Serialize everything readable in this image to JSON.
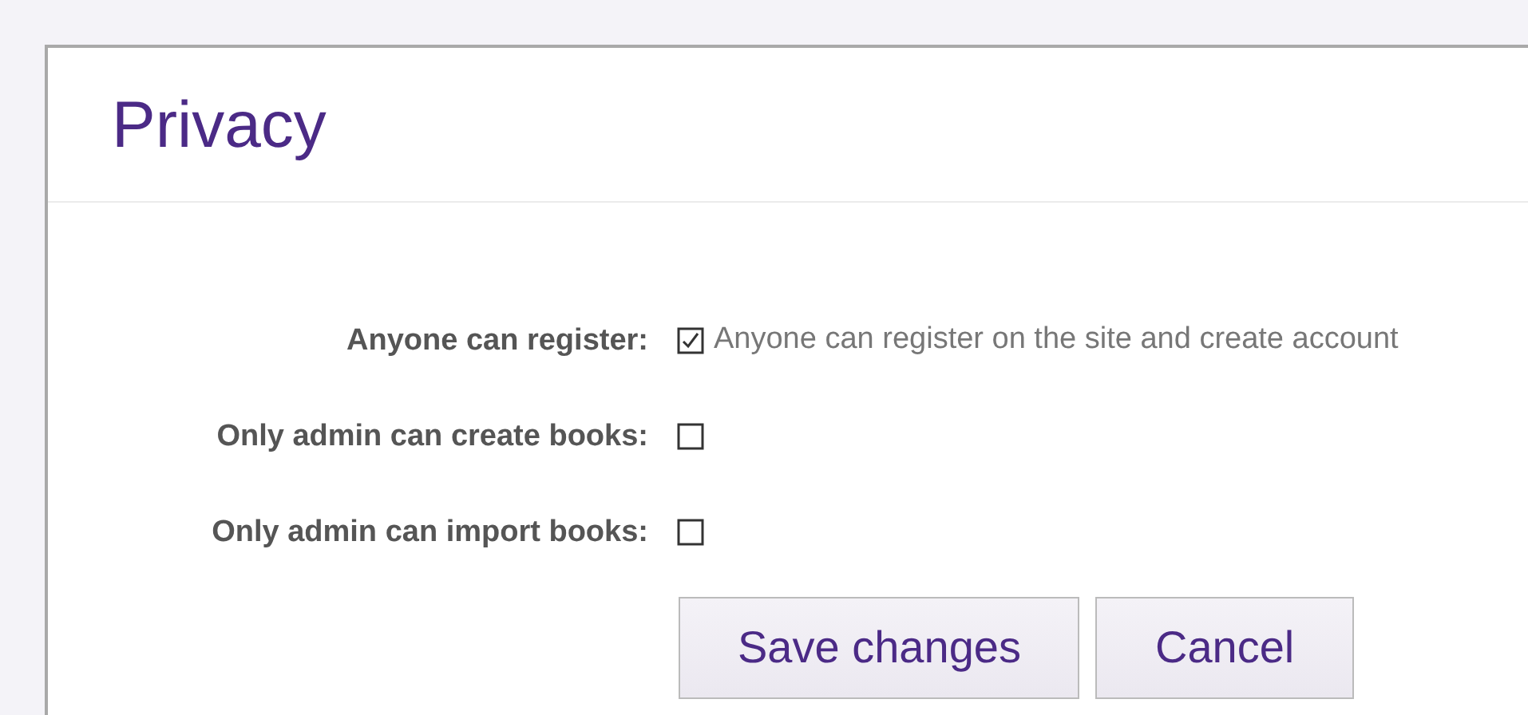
{
  "title": "Privacy",
  "settings": [
    {
      "label": "Anyone can register:",
      "checked": true,
      "description": "Anyone can register on the site and create account"
    },
    {
      "label": "Only admin can create books:",
      "checked": false
    },
    {
      "label": "Only admin can import books:",
      "checked": false
    }
  ],
  "buttons": [
    "Save changes",
    "Cancel"
  ]
}
